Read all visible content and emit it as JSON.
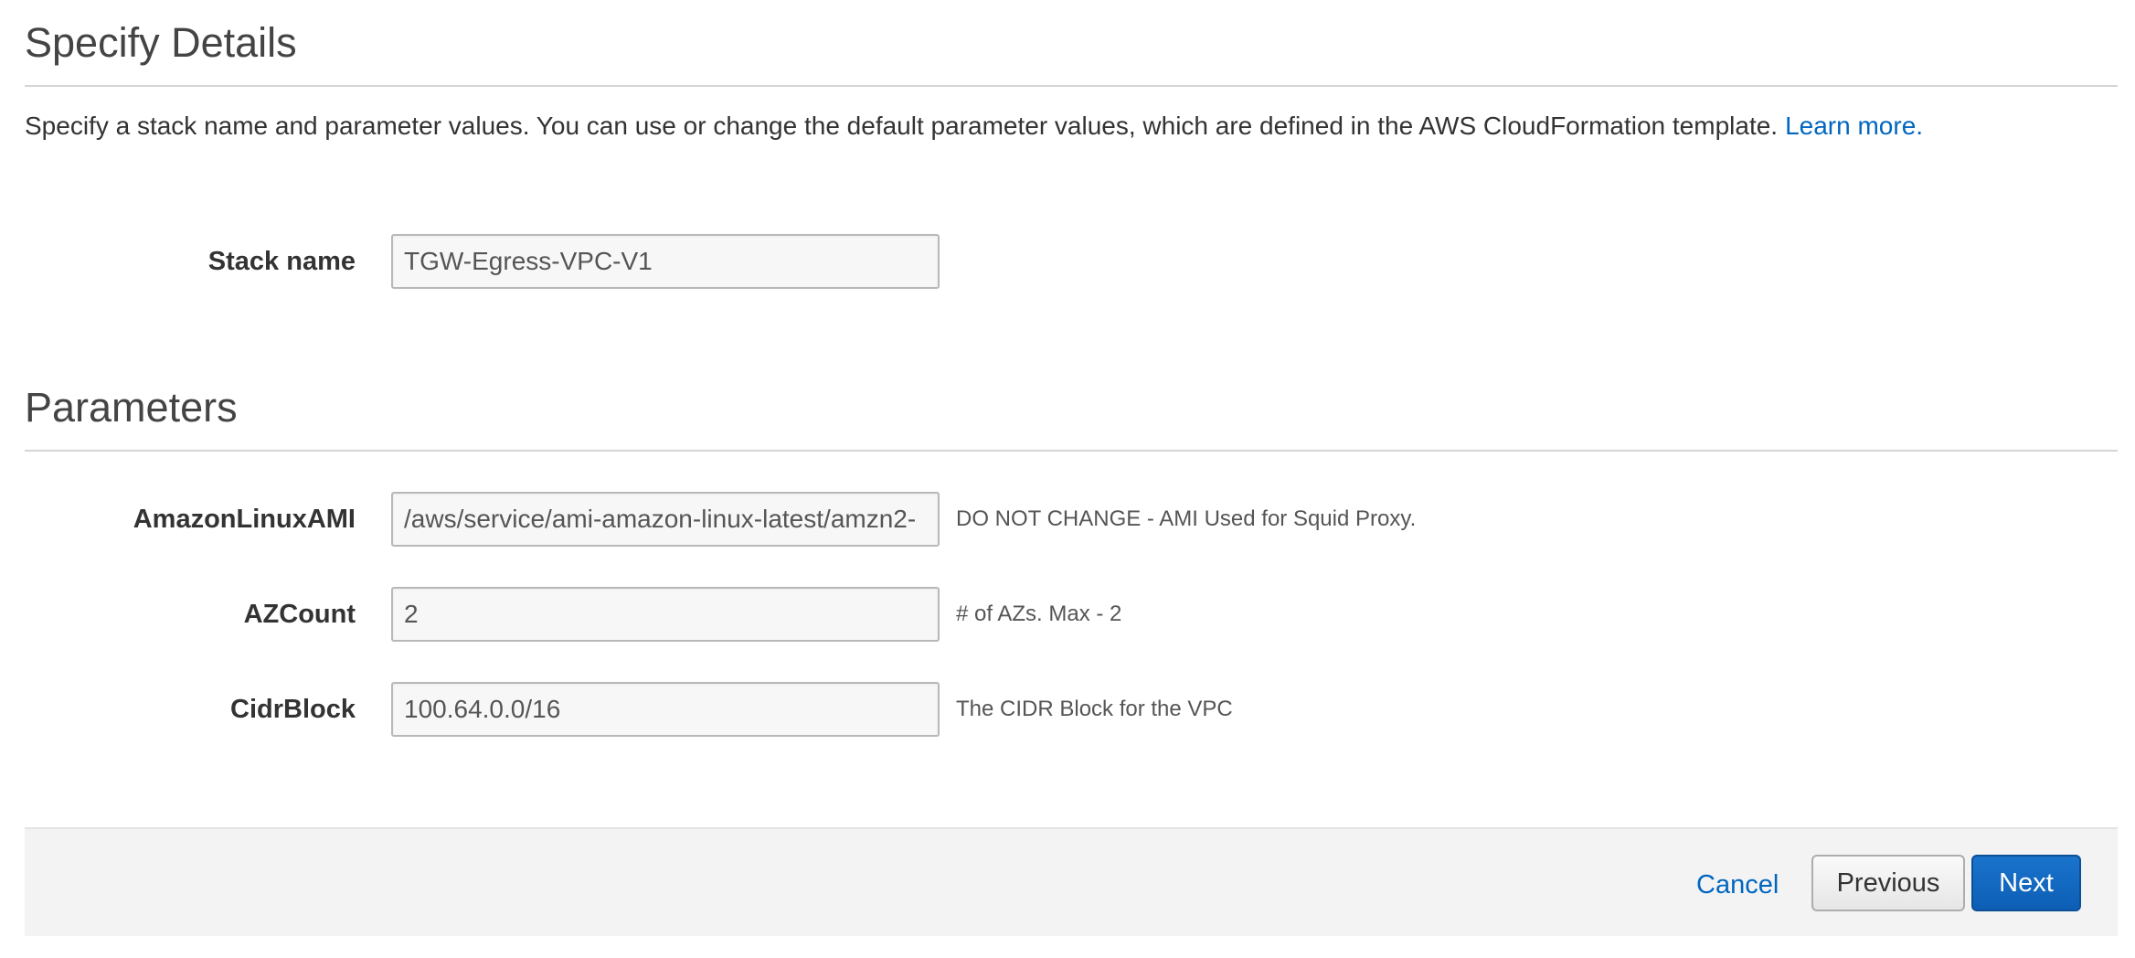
{
  "details": {
    "title": "Specify Details",
    "intro_text": "Specify a stack name and parameter values. You can use or change the default parameter values, which are defined in the AWS CloudFormation template.",
    "learn_more_label": "Learn more.",
    "stack_name": {
      "label": "Stack name",
      "value": "TGW-Egress-VPC-V1"
    }
  },
  "parameters": {
    "title": "Parameters",
    "fields": [
      {
        "label": "AmazonLinuxAMI",
        "value": "/aws/service/ami-amazon-linux-latest/amzn2-",
        "hint": "DO NOT CHANGE - AMI Used for Squid Proxy."
      },
      {
        "label": "AZCount",
        "value": "2",
        "hint": "# of AZs. Max - 2"
      },
      {
        "label": "CidrBlock",
        "value": "100.64.0.0/16",
        "hint": "The CIDR Block for the VPC"
      }
    ]
  },
  "footer": {
    "cancel_label": "Cancel",
    "previous_label": "Previous",
    "next_label": "Next"
  },
  "colors": {
    "link": "#0066c0",
    "primary_button": "#0d5fb5",
    "footer_background": "#f3f3f3"
  }
}
